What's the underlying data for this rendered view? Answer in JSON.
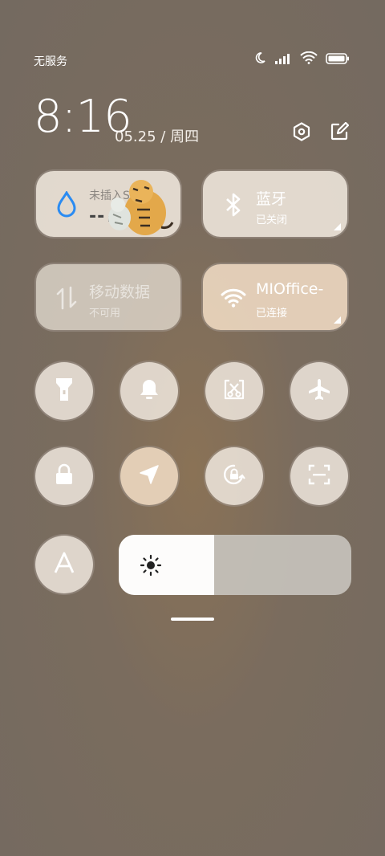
{
  "status": {
    "carrier": "无服务",
    "icons": [
      "moon-icon",
      "signal-icon",
      "wifi-icon",
      "battery-icon"
    ]
  },
  "header": {
    "time": "8:16",
    "date": "05.25",
    "separator": "/",
    "weekday": "周四"
  },
  "tiles": {
    "data_usage": {
      "title": "未插入SIM卡",
      "value": "--",
      "unit": "MB"
    },
    "bluetooth": {
      "title": "蓝牙",
      "status": "已关闭"
    },
    "mobile_data": {
      "title": "移动数据",
      "status": "不可用"
    },
    "wifi": {
      "title": "MIOffice-",
      "status": "已连接"
    }
  },
  "toggles_row1": [
    "flashlight-icon",
    "bell-icon",
    "screenshot-icon",
    "airplane-icon"
  ],
  "toggles_row2": [
    "lock-icon",
    "location-icon",
    "rotation-lock-icon",
    "scan-icon"
  ],
  "brightness": {
    "level": 0.41
  },
  "colors": {
    "accent_blue": "#2a8bf2",
    "tile_bg": "#f0e8de",
    "active_bg": "#e8d3bc"
  }
}
